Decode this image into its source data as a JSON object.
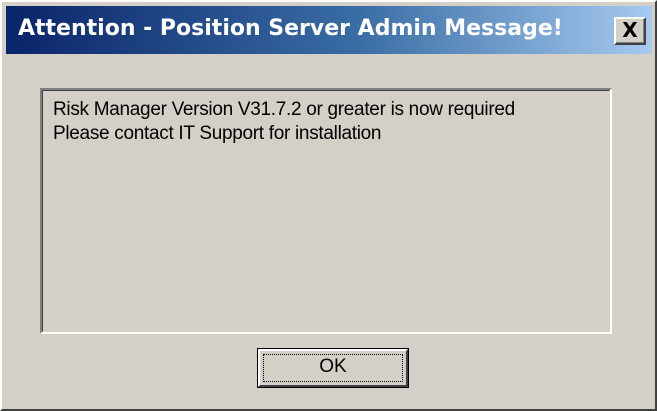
{
  "window": {
    "title": "Attention - Position Server Admin Message!",
    "close_glyph": "X",
    "close_icon": "close-icon"
  },
  "message": {
    "lines": [
      "Risk Manager Version V31.7.2 or greater is now required",
      "Please contact IT Support for installation"
    ]
  },
  "buttons": {
    "ok_label": "OK"
  },
  "colors": {
    "dialog_face": "#d4d0c8",
    "title_gradient_start": "#0a246a",
    "title_gradient_end": "#a6caf0",
    "title_text": "#ffffff"
  }
}
